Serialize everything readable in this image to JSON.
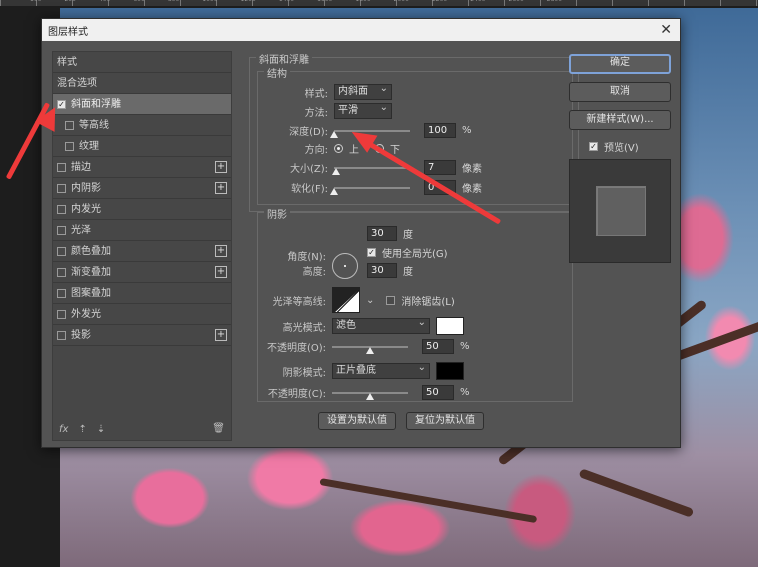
{
  "ruler": [
    "100",
    "200",
    "400",
    "600",
    "800",
    "1000",
    "1200",
    "1400",
    "1600",
    "1800",
    "2000",
    "2200",
    "2400",
    "2600",
    "2800"
  ],
  "dialog": {
    "title": "图层样式",
    "left_panel": {
      "header": "样式",
      "blend": "混合选项",
      "items": [
        {
          "label": "斜面和浮雕",
          "checked": true,
          "selected": true,
          "plus": false
        },
        {
          "label": "等高线",
          "checked": false,
          "sub": true,
          "plus": false
        },
        {
          "label": "纹理",
          "checked": false,
          "sub": true,
          "plus": false
        },
        {
          "label": "描边",
          "checked": false,
          "plus": true
        },
        {
          "label": "内阴影",
          "checked": false,
          "plus": true
        },
        {
          "label": "内发光",
          "checked": false,
          "plus": false
        },
        {
          "label": "光泽",
          "checked": false,
          "plus": false
        },
        {
          "label": "颜色叠加",
          "checked": false,
          "plus": true
        },
        {
          "label": "渐变叠加",
          "checked": false,
          "plus": true
        },
        {
          "label": "图案叠加",
          "checked": false,
          "plus": false
        },
        {
          "label": "外发光",
          "checked": false,
          "plus": false
        },
        {
          "label": "投影",
          "checked": false,
          "plus": true
        }
      ],
      "fx": "fx"
    },
    "bevel": {
      "section_title": "斜面和浮雕",
      "structure_title": "结构",
      "style_label": "样式:",
      "style_value": "内斜面",
      "technique_label": "方法:",
      "technique_value": "平滑",
      "depth_label": "深度(D):",
      "depth_value": "100",
      "depth_unit": "%",
      "depth_fraction": 0.0,
      "direction_label": "方向:",
      "dir_up": "上",
      "dir_down": "下",
      "size_label": "大小(Z):",
      "size_value": "7",
      "size_unit": "像素",
      "size_fraction": 0.03,
      "soften_label": "软化(F):",
      "soften_value": "0",
      "soften_unit": "像素",
      "soften_fraction": 0.0
    },
    "shading": {
      "title": "阴影",
      "angle_label": "角度(N):",
      "angle_value": "30",
      "angle_unit": "度",
      "global_light": "使用全局光(G)",
      "altitude_label": "高度:",
      "altitude_value": "30",
      "altitude_unit": "度",
      "gloss_label": "光泽等高线:",
      "anti_alias": "消除锯齿(L)",
      "highlight_label": "高光模式:",
      "highlight_value": "滤色",
      "highlight_color": "#ffffff",
      "hl_opacity_label": "不透明度(O):",
      "hl_opacity_value": "50",
      "hl_opacity_unit": "%",
      "hl_opacity_fraction": 0.5,
      "shadow_label": "阴影模式:",
      "shadow_value": "正片叠底",
      "shadow_color": "#000000",
      "sh_opacity_label": "不透明度(C):",
      "sh_opacity_value": "50",
      "sh_opacity_unit": "%",
      "sh_opacity_fraction": 0.5
    },
    "buttons": {
      "ok": "确定",
      "cancel": "取消",
      "new_style": "新建样式(W)...",
      "preview": "预览(V)",
      "make_default": "设置为默认值",
      "reset_default": "复位为默认值"
    }
  }
}
